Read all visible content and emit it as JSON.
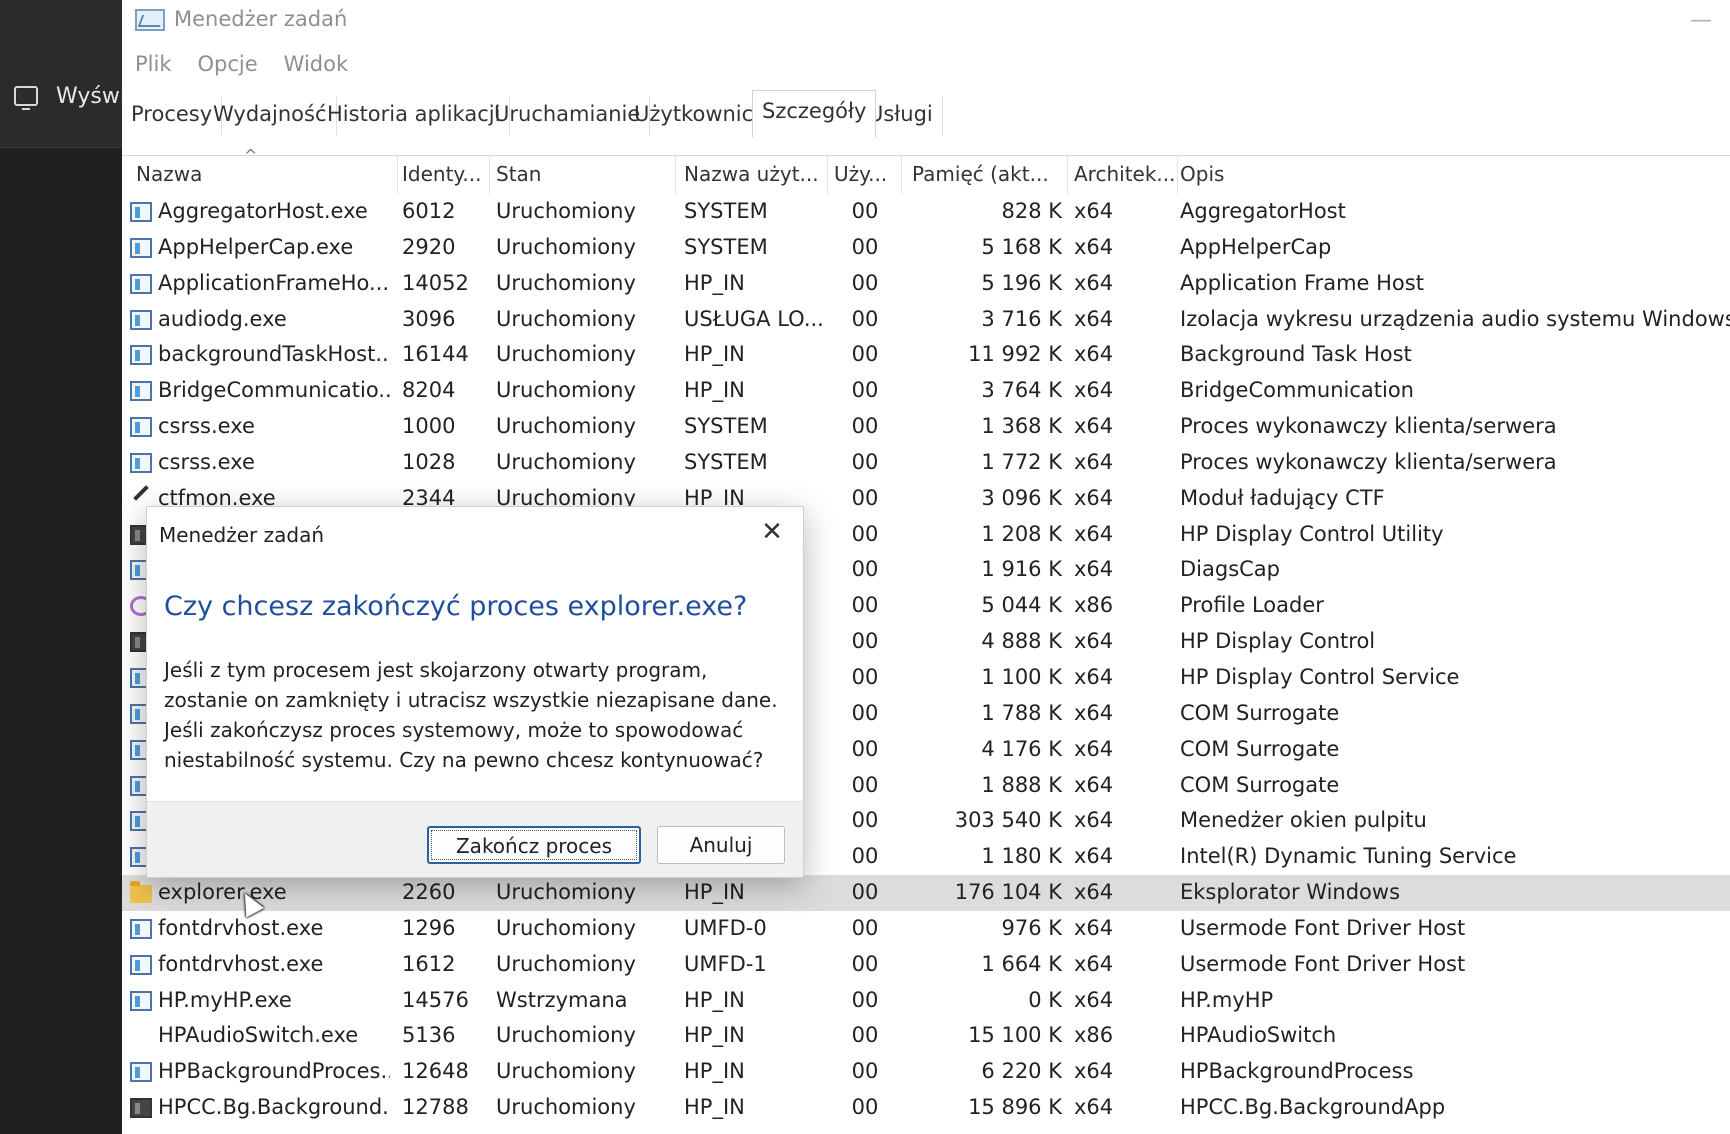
{
  "left_pane": {
    "label": "Wyświ"
  },
  "window": {
    "title": "Menedżer zadań",
    "menu": [
      "Plik",
      "Opcje",
      "Widok"
    ],
    "tabs": [
      "Procesy",
      "Wydajność",
      "Historia aplikacji",
      "Uruchamianie",
      "Użytkownicy",
      "Szczegóły",
      "Usługi"
    ],
    "active_tab": "Szczegóły"
  },
  "table": {
    "headers": [
      "Nazwa",
      "Identy...",
      "Stan",
      "Nazwa użyt...",
      "Uży...",
      "Pamięć (akt...",
      "Architek...",
      "Opis"
    ],
    "rows": [
      {
        "name": "AggregatorHost.exe",
        "pid": "6012",
        "status": "Uruchomiony",
        "user": "SYSTEM",
        "cpu": "00",
        "mem": "828 K",
        "arch": "x64",
        "desc": "AggregatorHost",
        "icon": "app-icon"
      },
      {
        "name": "AppHelperCap.exe",
        "pid": "2920",
        "status": "Uruchomiony",
        "user": "SYSTEM",
        "cpu": "00",
        "mem": "5 168 K",
        "arch": "x64",
        "desc": "AppHelperCap",
        "icon": "app-icon"
      },
      {
        "name": "ApplicationFrameHo...",
        "pid": "14052",
        "status": "Uruchomiony",
        "user": "HP_IN",
        "cpu": "00",
        "mem": "5 196 K",
        "arch": "x64",
        "desc": "Application Frame Host",
        "icon": "app-icon"
      },
      {
        "name": "audiodg.exe",
        "pid": "3096",
        "status": "Uruchomiony",
        "user": "USŁUGA LO...",
        "cpu": "00",
        "mem": "3 716 K",
        "arch": "x64",
        "desc": "Izolacja wykresu urządzenia audio systemu Windows",
        "icon": "app-icon"
      },
      {
        "name": "backgroundTaskHost....",
        "pid": "16144",
        "status": "Uruchomiony",
        "user": "HP_IN",
        "cpu": "00",
        "mem": "11 992 K",
        "arch": "x64",
        "desc": "Background Task Host",
        "icon": "app-icon"
      },
      {
        "name": "BridgeCommunicatio...",
        "pid": "8204",
        "status": "Uruchomiony",
        "user": "HP_IN",
        "cpu": "00",
        "mem": "3 764 K",
        "arch": "x64",
        "desc": "BridgeCommunication",
        "icon": "app-icon"
      },
      {
        "name": "csrss.exe",
        "pid": "1000",
        "status": "Uruchomiony",
        "user": "SYSTEM",
        "cpu": "00",
        "mem": "1 368 K",
        "arch": "x64",
        "desc": "Proces wykonawczy klienta/serwera",
        "icon": "app-icon"
      },
      {
        "name": "csrss.exe",
        "pid": "1028",
        "status": "Uruchomiony",
        "user": "SYSTEM",
        "cpu": "00",
        "mem": "1 772 K",
        "arch": "x64",
        "desc": "Proces wykonawczy klienta/serwera",
        "icon": "app-icon"
      },
      {
        "name": "ctfmon.exe",
        "pid": "2344",
        "status": "Uruchomiony",
        "user": "HP_IN",
        "cpu": "00",
        "mem": "3 096 K",
        "arch": "x64",
        "desc": "Moduł ładujący CTF",
        "icon": "pen-icon"
      },
      {
        "name": "",
        "pid": "",
        "status": "",
        "user": "",
        "cpu": "00",
        "mem": "1 208 K",
        "arch": "x64",
        "desc": "HP Display Control Utility",
        "icon": "dark-app-icon"
      },
      {
        "name": "",
        "pid": "",
        "status": "",
        "user": "",
        "cpu": "00",
        "mem": "1 916 K",
        "arch": "x64",
        "desc": "DiagsCap",
        "icon": "app-icon"
      },
      {
        "name": "",
        "pid": "",
        "status": "",
        "user": "",
        "cpu": "00",
        "mem": "5 044 K",
        "arch": "x86",
        "desc": "Profile Loader",
        "icon": "circle-icon"
      },
      {
        "name": "",
        "pid": "",
        "status": "",
        "user": "",
        "cpu": "00",
        "mem": "4 888 K",
        "arch": "x64",
        "desc": "HP Display Control",
        "icon": "dark-app-icon"
      },
      {
        "name": "",
        "pid": "",
        "status": "",
        "user": "",
        "cpu": "00",
        "mem": "1 100 K",
        "arch": "x64",
        "desc": "HP Display Control Service",
        "icon": "app-icon"
      },
      {
        "name": "",
        "pid": "",
        "status": "",
        "user": "",
        "cpu": "00",
        "mem": "1 788 K",
        "arch": "x64",
        "desc": "COM Surrogate",
        "icon": "app-icon"
      },
      {
        "name": "",
        "pid": "",
        "status": "",
        "user": "",
        "cpu": "00",
        "mem": "4 176 K",
        "arch": "x64",
        "desc": "COM Surrogate",
        "icon": "app-icon"
      },
      {
        "name": "",
        "pid": "",
        "status": "",
        "user": "",
        "cpu": "00",
        "mem": "1 888 K",
        "arch": "x64",
        "desc": "COM Surrogate",
        "icon": "app-icon"
      },
      {
        "name": "",
        "pid": "",
        "status": "",
        "user": "",
        "cpu": "00",
        "mem": "303 540 K",
        "arch": "x64",
        "desc": "Menedżer okien pulpitu",
        "icon": "app-icon"
      },
      {
        "name": "",
        "pid": "",
        "status": "",
        "user": "",
        "cpu": "00",
        "mem": "1 180 K",
        "arch": "x64",
        "desc": "Intel(R) Dynamic Tuning Service",
        "icon": "app-icon"
      },
      {
        "name": "explorer.exe",
        "pid": "2260",
        "status": "Uruchomiony",
        "user": "HP_IN",
        "cpu": "00",
        "mem": "176 104 K",
        "arch": "x64",
        "desc": "Eksplorator Windows",
        "icon": "folder-icon",
        "selected": true
      },
      {
        "name": "fontdrvhost.exe",
        "pid": "1296",
        "status": "Uruchomiony",
        "user": "UMFD-0",
        "cpu": "00",
        "mem": "976 K",
        "arch": "x64",
        "desc": "Usermode Font Driver Host",
        "icon": "app-icon"
      },
      {
        "name": "fontdrvhost.exe",
        "pid": "1612",
        "status": "Uruchomiony",
        "user": "UMFD-1",
        "cpu": "00",
        "mem": "1 664 K",
        "arch": "x64",
        "desc": "Usermode Font Driver Host",
        "icon": "app-icon"
      },
      {
        "name": "HP.myHP.exe",
        "pid": "14576",
        "status": "Wstrzymana",
        "user": "HP_IN",
        "cpu": "00",
        "mem": "0 K",
        "arch": "x64",
        "desc": "HP.myHP",
        "icon": "app-icon"
      },
      {
        "name": "HPAudioSwitch.exe",
        "pid": "5136",
        "status": "Uruchomiony",
        "user": "HP_IN",
        "cpu": "00",
        "mem": "15 100 K",
        "arch": "x86",
        "desc": "HPAudioSwitch",
        "icon": "blank-icon"
      },
      {
        "name": "HPBackgroundProces...",
        "pid": "12648",
        "status": "Uruchomiony",
        "user": "HP_IN",
        "cpu": "00",
        "mem": "6 220 K",
        "arch": "x64",
        "desc": "HPBackgroundProcess",
        "icon": "app-icon"
      },
      {
        "name": "HPCC.Bg.Background...",
        "pid": "12788",
        "status": "Uruchomiony",
        "user": "HP_IN",
        "cpu": "00",
        "mem": "15 896 K",
        "arch": "x64",
        "desc": "HPCC.Bg.BackgroundApp",
        "icon": "dark-app-icon"
      }
    ]
  },
  "dialog": {
    "title": "Menedżer zadań",
    "heading": "Czy chcesz zakończyć proces explorer.exe?",
    "body_lines": [
      "Jeśli z tym procesem jest skojarzony otwarty program,",
      "zostanie on zamknięty i utracisz wszystkie niezapisane dane.",
      "Jeśli zakończysz proces systemowy, może to spowodować",
      "niestabilność systemu. Czy na pewno chcesz kontynuować?"
    ],
    "confirm_label": "Zakończ proces",
    "cancel_label": "Anuluj"
  }
}
